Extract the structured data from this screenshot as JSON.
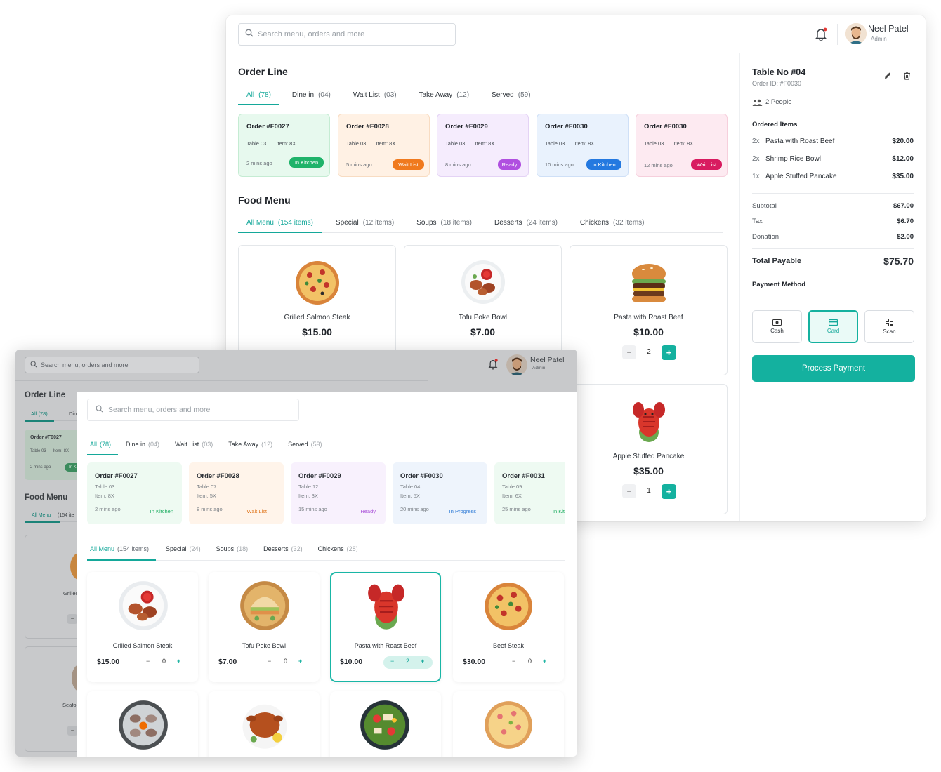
{
  "app": {
    "search_placeholder": "Search menu, orders and more",
    "user": {
      "name": "Neel Patel",
      "role": "Admin"
    },
    "accent": "#14b19f"
  },
  "back": {
    "order_line": {
      "title": "Order Line",
      "tabs": [
        {
          "label": "All",
          "count": "(78)"
        },
        {
          "label": "Dine in",
          "count": "(04)"
        },
        {
          "label": "Wait List",
          "count": "(03)"
        },
        {
          "label": "Take Away",
          "count": "(12)"
        },
        {
          "label": "Served",
          "count": "(59)"
        }
      ],
      "orders": [
        {
          "id": "Order #F0027",
          "table": "Table 03",
          "items": "Item: 8X",
          "ago": "2 mins ago",
          "status": "In Kitchen",
          "status_color": "#1fb36a"
        },
        {
          "id": "Order #F0028",
          "table": "Table 03",
          "items": "Item: 8X",
          "ago": "5 mins ago",
          "status": "Wait List",
          "status_color": "#f07a1e"
        },
        {
          "id": "Order #F0029",
          "table": "Table 03",
          "items": "Item: 8X",
          "ago": "8 mins ago",
          "status": "Ready",
          "status_color": "#b04fe0"
        },
        {
          "id": "Order #F0030",
          "table": "Table 03",
          "items": "Item: 8X",
          "ago": "10 mins ago",
          "status": "In Kitchen",
          "status_color": "#2479e0"
        },
        {
          "id": "Order #F0030",
          "table": "Table 03",
          "items": "Item: 8X",
          "ago": "12 mins ago",
          "status": "Wait List",
          "status_color": "#d81b60"
        }
      ]
    },
    "food_menu": {
      "title": "Food Menu",
      "tabs": [
        {
          "label": "All Menu",
          "count": "(154 items)"
        },
        {
          "label": "Special",
          "count": "(12 items)"
        },
        {
          "label": "Soups",
          "count": "(18 items)"
        },
        {
          "label": "Desserts",
          "count": "(24 items)"
        },
        {
          "label": "Chickens",
          "count": "(32 items)"
        }
      ],
      "items": [
        {
          "name": "Grilled Salmon Steak",
          "price": "$15.00",
          "icon": "pizza-image"
        },
        {
          "name": "Tofu Poke Bowl",
          "price": "$7.00",
          "icon": "chicken-plate-image"
        },
        {
          "name": "Pasta with Roast Beef",
          "price": "$10.00",
          "qty": "2",
          "icon": "burger-image"
        },
        {
          "name": "Apple Stuffed Pancake",
          "price": "$35.00",
          "qty": "1",
          "icon": "lobster-image"
        }
      ]
    },
    "order_panel": {
      "table": "Table No #04",
      "order_id": "Order ID: #F0030",
      "people": "2 People",
      "items_title": "Ordered Items",
      "items": [
        {
          "qty": "2x",
          "name": "Pasta with Roast Beef",
          "price": "$20.00"
        },
        {
          "qty": "2x",
          "name": "Shrimp Rice Bowl",
          "price": "$12.00"
        },
        {
          "qty": "1x",
          "name": "Apple Stuffed Pancake",
          "price": "$35.00"
        }
      ],
      "subtotal_label": "Subtotal",
      "subtotal": "$67.00",
      "tax_label": "Tax",
      "tax": "$6.70",
      "donation_label": "Donation",
      "donation": "$2.00",
      "total_label": "Total Payable",
      "total": "$75.70",
      "payment_title": "Payment Method",
      "methods": [
        "Cash",
        "Card",
        "Scan"
      ],
      "process_label": "Process Payment"
    }
  },
  "front": {
    "bg_order_title": "Order Line",
    "bg_tab_all": "All",
    "bg_tab_all_count": "(78)",
    "bg_tab_din": "Din",
    "bg_order": {
      "id": "Order #F0027",
      "table": "Table 03",
      "items": "Item: 8X",
      "ago": "2 mins ago",
      "badge": "In K"
    },
    "bg_food_title": "Food Menu",
    "bg_food_tab": "All Menu",
    "bg_food_tab_count": "(154 ite",
    "bg_food_names": [
      "Grillec",
      "Seafo"
    ],
    "tabs": [
      {
        "label": "All",
        "count": "(78)"
      },
      {
        "label": "Dine in",
        "count": "(04)"
      },
      {
        "label": "Wait List",
        "count": "(03)"
      },
      {
        "label": "Take Away",
        "count": "(12)"
      },
      {
        "label": "Served",
        "count": "(59)"
      }
    ],
    "orders": [
      {
        "id": "Order #F0027",
        "table": "Table 03",
        "items": "Item: 8X",
        "ago": "2 mins ago",
        "status": "In Kitchen",
        "color": "#1fae63"
      },
      {
        "id": "Order #F0028",
        "table": "Table 07",
        "items": "Item: 5X",
        "ago": "8 mins ago",
        "status": "Wait List",
        "color": "#e0761c"
      },
      {
        "id": "Order #F0029",
        "table": "Table 12",
        "items": "Item: 3X",
        "ago": "15 mins ago",
        "status": "Ready",
        "color": "#a94fd8"
      },
      {
        "id": "Order #F0030",
        "table": "Table 04",
        "items": "Item: 5X",
        "ago": "20 mins ago",
        "status": "In Progress",
        "color": "#2c79d6"
      },
      {
        "id": "Order #F0031",
        "table": "Table 09",
        "items": "Item: 6X",
        "ago": "25 mins ago",
        "status": "In Kit",
        "color": "#1fae63"
      }
    ],
    "food_tabs": [
      {
        "label": "All Menu",
        "count": "(154 items)"
      },
      {
        "label": "Special",
        "count": "(24)"
      },
      {
        "label": "Soups",
        "count": "(18)"
      },
      {
        "label": "Desserts",
        "count": "(32)"
      },
      {
        "label": "Chickens",
        "count": "(28)"
      }
    ],
    "foods": [
      {
        "name": "Grilled Salmon Steak",
        "price": "$15.00",
        "qty": "0"
      },
      {
        "name": "Tofu Poke Bowl",
        "price": "$7.00",
        "qty": "0"
      },
      {
        "name": "Pasta with Roast Beef",
        "price": "$10.00",
        "qty": "2"
      },
      {
        "name": "Beef Steak",
        "price": "$30.00",
        "qty": "0"
      }
    ]
  }
}
